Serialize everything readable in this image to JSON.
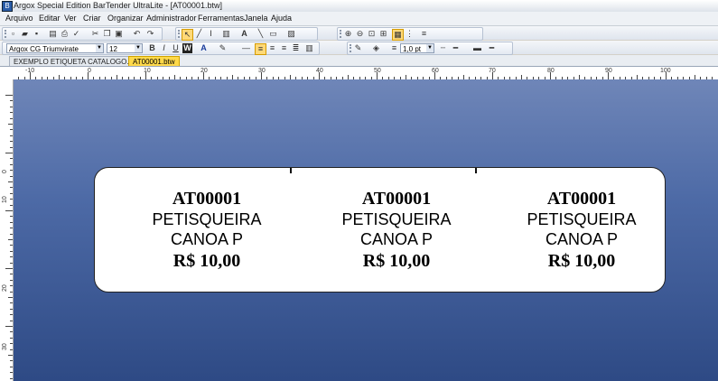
{
  "window": {
    "title": "Argox Special Edition BarTender UltraLite - [AT00001.btw]"
  },
  "menu": [
    "Arquivo",
    "Editar",
    "Ver",
    "Criar",
    "Organizar",
    "Administrador",
    "Ferramentas",
    "Janela",
    "Ajuda"
  ],
  "format": {
    "font_name": "Argox CG Triumvirate",
    "font_size": "12",
    "line_weight": "1,0 pt"
  },
  "tabs": [
    {
      "label": "EXEMPLO ETIQUETA CATALOGO.btw",
      "active": false
    },
    {
      "label": "AT00001.btw",
      "active": true
    }
  ],
  "ruler": {
    "top_labels": [
      "-10",
      "0",
      "10",
      "20",
      "30",
      "40",
      "50",
      "60",
      "70",
      "80",
      "90",
      "100"
    ],
    "left_labels": [
      "0",
      "10",
      "20",
      "30"
    ]
  },
  "label": {
    "cells": [
      {
        "code": "AT00001",
        "line1": "PETISQUEIRA",
        "line2": "CANOA P",
        "price": "R$ 10,00"
      },
      {
        "code": "AT00001",
        "line1": "PETISQUEIRA",
        "line2": "CANOA P",
        "price": "R$ 10,00"
      },
      {
        "code": "AT00001",
        "line1": "PETISQUEIRA",
        "line2": "CANOA P",
        "price": "R$ 10,00"
      }
    ]
  }
}
